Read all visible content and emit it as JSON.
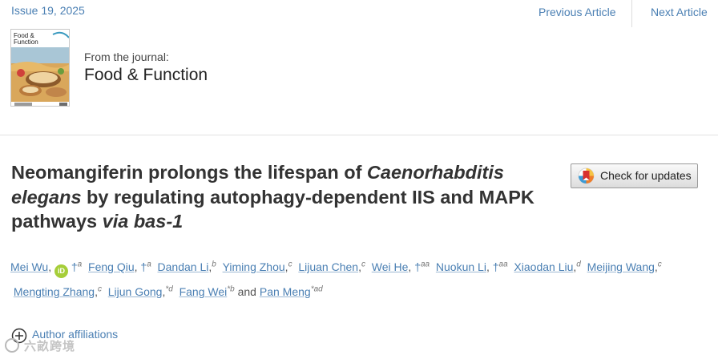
{
  "header": {
    "issue": "Issue 19, 2025",
    "prev_label": "Previous Article",
    "next_label": "Next Article"
  },
  "journal": {
    "from_label": "From the journal:",
    "name": "Food & Function",
    "cover_title_line1": "Food &",
    "cover_title_line2": "Function"
  },
  "article": {
    "title_part1": "Neomangiferin prolongs the lifespan of ",
    "title_italic1": "Caenorhabditis elegans",
    "title_part2": " by regulating autophagy-dependent IIS and MAPK pathways ",
    "title_italic2": "via bas-1"
  },
  "check_updates": {
    "label": "Check for updates"
  },
  "authors": [
    {
      "name": "Mei Wu",
      "orcid": true,
      "dagger": true,
      "aff": "a"
    },
    {
      "name": "Feng Qiu",
      "dagger": true,
      "aff": "a"
    },
    {
      "name": "Dandan Li",
      "aff": "b"
    },
    {
      "name": "Yiming Zhou",
      "aff": "c"
    },
    {
      "name": "Lijuan Chen",
      "aff": "c"
    },
    {
      "name": "Wei He",
      "dagger": true,
      "aff": "aa"
    },
    {
      "name": "Nuokun Li",
      "dagger": true,
      "aff": "aa"
    },
    {
      "name": "Xiaodan Liu",
      "aff": "d"
    },
    {
      "name": "Meijing Wang",
      "aff": "c"
    },
    {
      "name": "Mengting Zhang",
      "aff": "c"
    },
    {
      "name": "Lijun Gong",
      "aff": "*d"
    },
    {
      "name": "Fang Wei",
      "aff": "*b"
    },
    {
      "name": "Pan Meng",
      "aff": "*ad"
    }
  ],
  "author_symbols": {
    "dagger": "†",
    "orcid": "iD",
    "and": "and"
  },
  "affiliations": {
    "label": "Author affiliations"
  },
  "watermark": {
    "text": "六畝跨境"
  },
  "colors": {
    "link": "#4a7fb3",
    "orcid": "#a6ce39",
    "title": "#333333"
  }
}
